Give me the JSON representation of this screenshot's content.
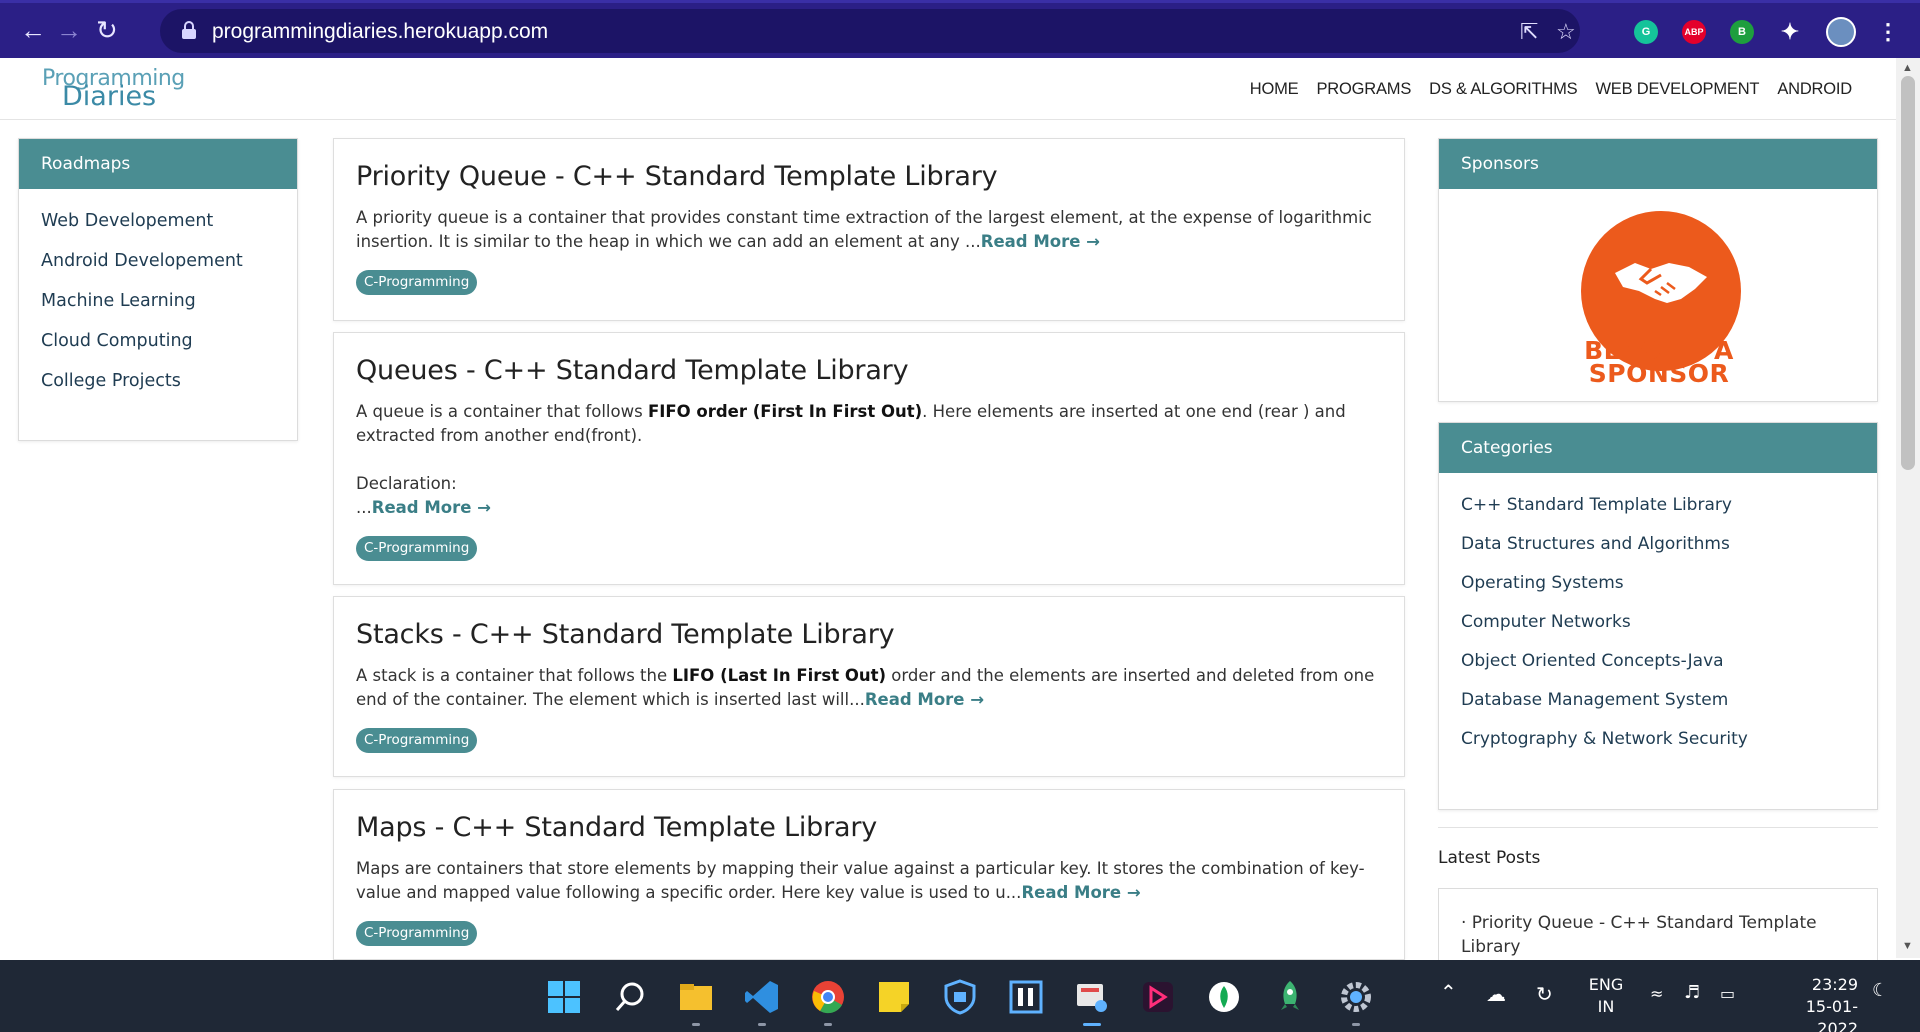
{
  "browser": {
    "url": "programmingdiaries.herokuapp.com"
  },
  "site": {
    "logo_line1": "Programming",
    "logo_line2": "Diaries",
    "nav": [
      "HOME",
      "PROGRAMS",
      "DS & ALGORITHMS",
      "WEB DEVELOPMENT",
      "ANDROID"
    ]
  },
  "roadmaps": {
    "title": "Roadmaps",
    "items": [
      "Web Developement",
      "Android Developement",
      "Machine Learning",
      "Cloud Computing",
      "College Projects"
    ]
  },
  "posts": [
    {
      "title": "Priority Queue - C++ Standard Template Library",
      "text": "A priority queue is a container that provides constant time extraction of the largest element, at the expense of logarithmic insertion. It is similar to the heap in which we can add an element at any ...",
      "read_more": "Read More →",
      "tag": "C-Programming"
    },
    {
      "title": "Queues - C++ Standard Template Library",
      "text_before": "A queue is a container that follows ",
      "text_bold": "FIFO order (First In First Out)",
      "text_after": ". Here elements are inserted at one end (rear ) and extracted from another end(front).",
      "declaration": "Declaration:",
      "ellipsis": "...",
      "read_more": "Read More →",
      "tag": "C-Programming"
    },
    {
      "title": "Stacks - C++ Standard Template Library",
      "text_before": "A stack is a container that follows the ",
      "text_bold": "LIFO (Last In First Out)",
      "text_after": " order and the elements are inserted and deleted from one end of the container. The element which is inserted last will...",
      "read_more": "Read More →",
      "tag": "C-Programming"
    },
    {
      "title": "Maps - C++ Standard Template Library",
      "text": "Maps are containers that store elements by mapping their value against a particular key. It stores the combination of key-value and mapped value following a specific order. Here key value is used to u...",
      "read_more": "Read More →",
      "tag": "C-Programming"
    }
  ],
  "sponsors": {
    "title": "Sponsors",
    "badge_line1": "BECOME A",
    "badge_line2": "SPONSOR"
  },
  "categories": {
    "title": "Categories",
    "items": [
      "C++ Standard Template Library",
      "Data Structures and Algorithms",
      "Operating Systems",
      "Computer Networks",
      "Object Oriented Concepts-Java",
      "Database Management System",
      "Cryptography & Network Security"
    ]
  },
  "latest_posts": {
    "title": "Latest Posts",
    "items": [
      "· Priority Queue - C++ Standard Template Library"
    ]
  },
  "taskbar": {
    "lang_line1": "ENG",
    "lang_line2": "IN",
    "time": "23:29",
    "date": "15-01-2022"
  },
  "colors": {
    "chrome_bg": "#2b1f86",
    "accent": "#4a8d92",
    "sponsor_orange": "#ec5a1c",
    "taskbar_bg": "#1f2836"
  }
}
